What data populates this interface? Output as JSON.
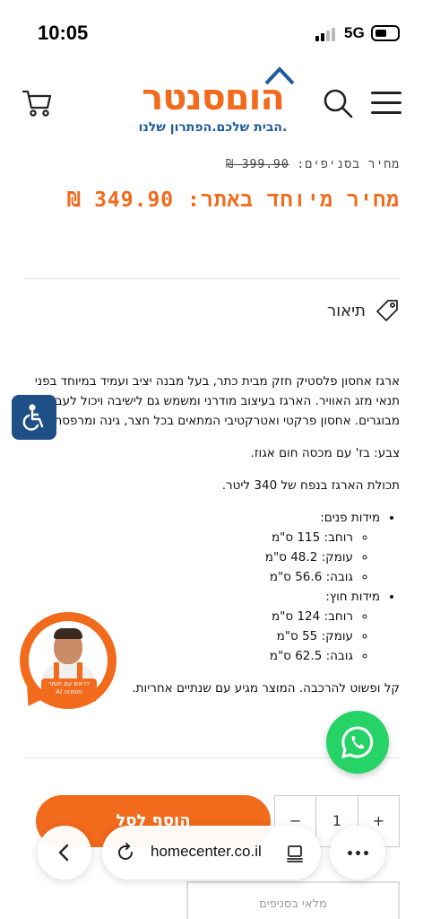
{
  "status_bar": {
    "time": "10:05",
    "network": "5G"
  },
  "header": {
    "logo_text": "הוםסנטר",
    "logo_tagline": "הבית שלכם.הפתרון שלנו.",
    "icons": [
      "cart-icon",
      "search-icon",
      "hamburger-menu-icon"
    ]
  },
  "price": {
    "branch_label": "מחיר בסניפים:",
    "branch_value": "399.90 ₪",
    "site_label": "מחיר מיוחד באתר:",
    "site_value": "349.90 ₪"
  },
  "description": {
    "heading": "תיאור",
    "intro": "ארגז אחסון פלסטיק חזק מבית כתר, בעל מבנה יציב ועמיד במיוחד בפני תנאי מזג האוויר. הארגז בעיצוב מודרני ומשמש גם לישיבה ויכול לעבור שני מבוגרים. אחסון פרקטי ואטרקטיבי המתאים בכל חצר, גינה ומרפסת.",
    "color": "צבע: בז' עם מכסה חום אגוז.",
    "capacity": "תכולת הארגז בנפח של 340 ליטר.",
    "inner_label": "מידות פנים:",
    "inner": [
      "רוחב: 115 ס\"מ",
      "עומק: 48.2 ס\"מ",
      "גובה: 56.6 ס\"מ"
    ],
    "outer_label": "מידות חוץ:",
    "outer": [
      "רוחב: 124 ס\"מ",
      "עומק: 55 ס\"מ",
      "גובה: 62.5 ס\"מ"
    ],
    "footer": "קל ופשוט להרכבה. המוצר מגיע עם שנתיים אחריות."
  },
  "ai_badge": {
    "label": "לראש עם תומר מומחה AI"
  },
  "purchase": {
    "add_to_cart": "הוסף לסל",
    "qty_minus": "−",
    "qty_value": "1",
    "qty_plus": "+",
    "stock_label": "מלאי בסניפים"
  },
  "browser": {
    "url": "homecenter.co.il"
  },
  "colors": {
    "accent": "#f26a1b",
    "brand_blue": "#1e5a9c",
    "whatsapp": "#25d366",
    "a11y": "#1e4f87"
  }
}
